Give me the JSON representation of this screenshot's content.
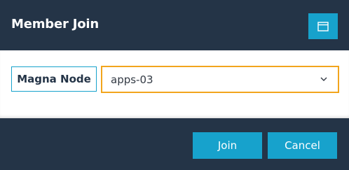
{
  "dialog": {
    "title": "Member Join",
    "window_icon": "window-icon"
  },
  "form": {
    "label": "Magna Node",
    "select_value": "apps-03",
    "select_icon": "chevron-down-icon"
  },
  "actions": {
    "join_label": "Join",
    "cancel_label": "Cancel"
  },
  "colors": {
    "header_bg": "#243447",
    "accent": "#17a2cc",
    "focus_border": "#f2a51d"
  }
}
